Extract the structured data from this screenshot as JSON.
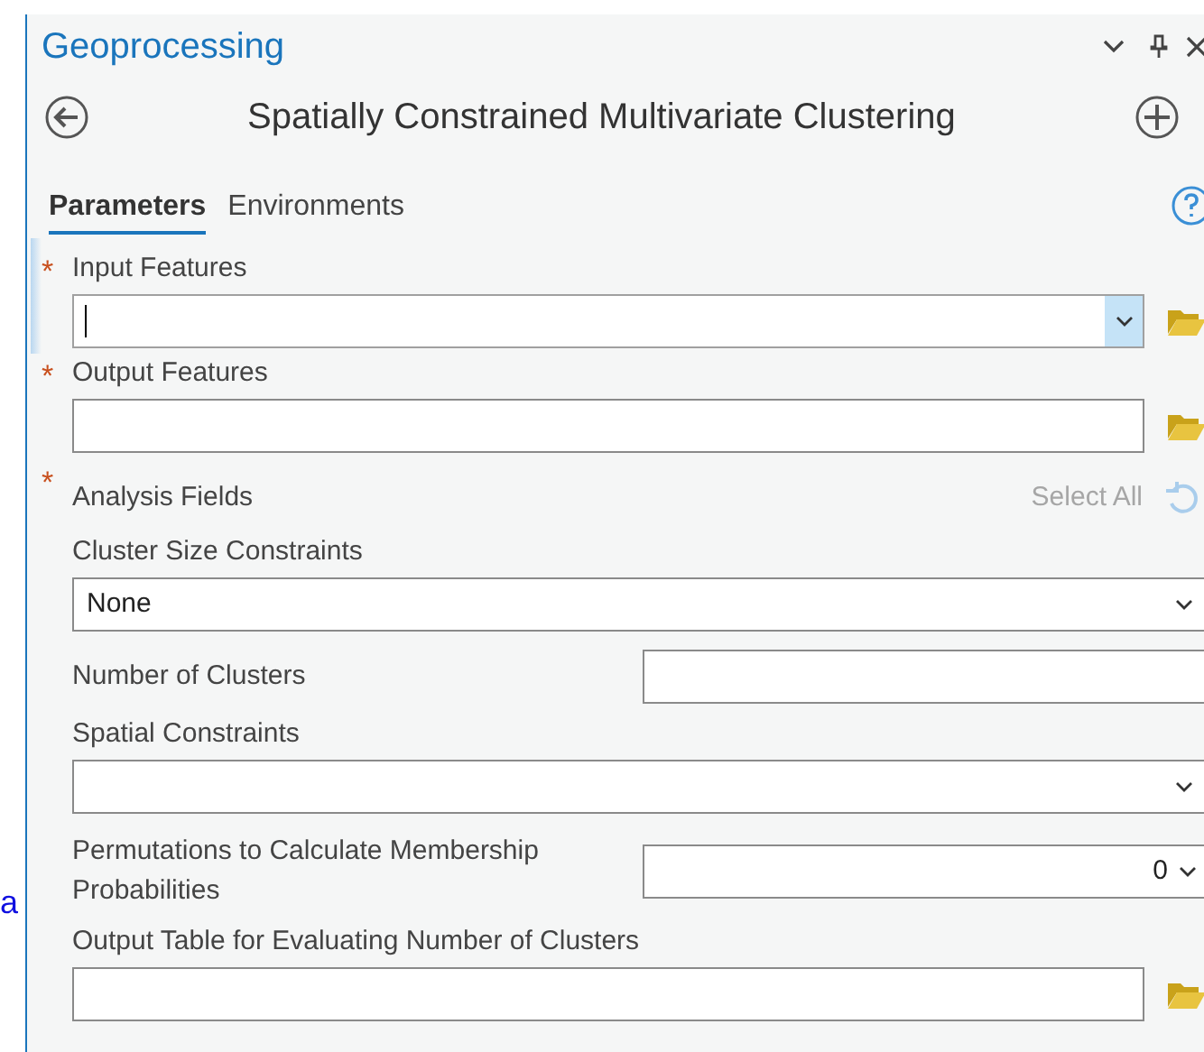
{
  "stray_text": "a",
  "required_marker": "*",
  "panel": {
    "title": "Geoprocessing"
  },
  "tool": {
    "title": "Spatially Constrained Multivariate Clustering"
  },
  "tabs": [
    {
      "label": "Parameters",
      "selected": true
    },
    {
      "label": "Environments",
      "selected": false
    }
  ],
  "parameters": [
    {
      "kind": "combo",
      "label": "Input Features",
      "required": true,
      "focused": true
    },
    {
      "kind": "browse",
      "label": "Output Features",
      "required": true,
      "focused": false
    },
    {
      "kind": "fields",
      "label": "Analysis Fields",
      "required": true,
      "focused": false,
      "action": "Select All"
    },
    {
      "kind": "dropdown",
      "label": "Cluster Size Constraints",
      "required": false,
      "focused": false,
      "value": "None"
    },
    {
      "kind": "inline_text",
      "label": "Number of Clusters",
      "required": false,
      "focused": false
    },
    {
      "kind": "dropdown",
      "label": "Spatial Constraints",
      "required": false,
      "focused": false
    },
    {
      "kind": "inline_dropdown",
      "label": "Permutations to Calculate Membership Probabilities",
      "required": false,
      "focused": false,
      "value": "0"
    },
    {
      "kind": "browse",
      "label": "Output Table for Evaluating Number of Clusters",
      "required": false,
      "focused": false
    }
  ]
}
